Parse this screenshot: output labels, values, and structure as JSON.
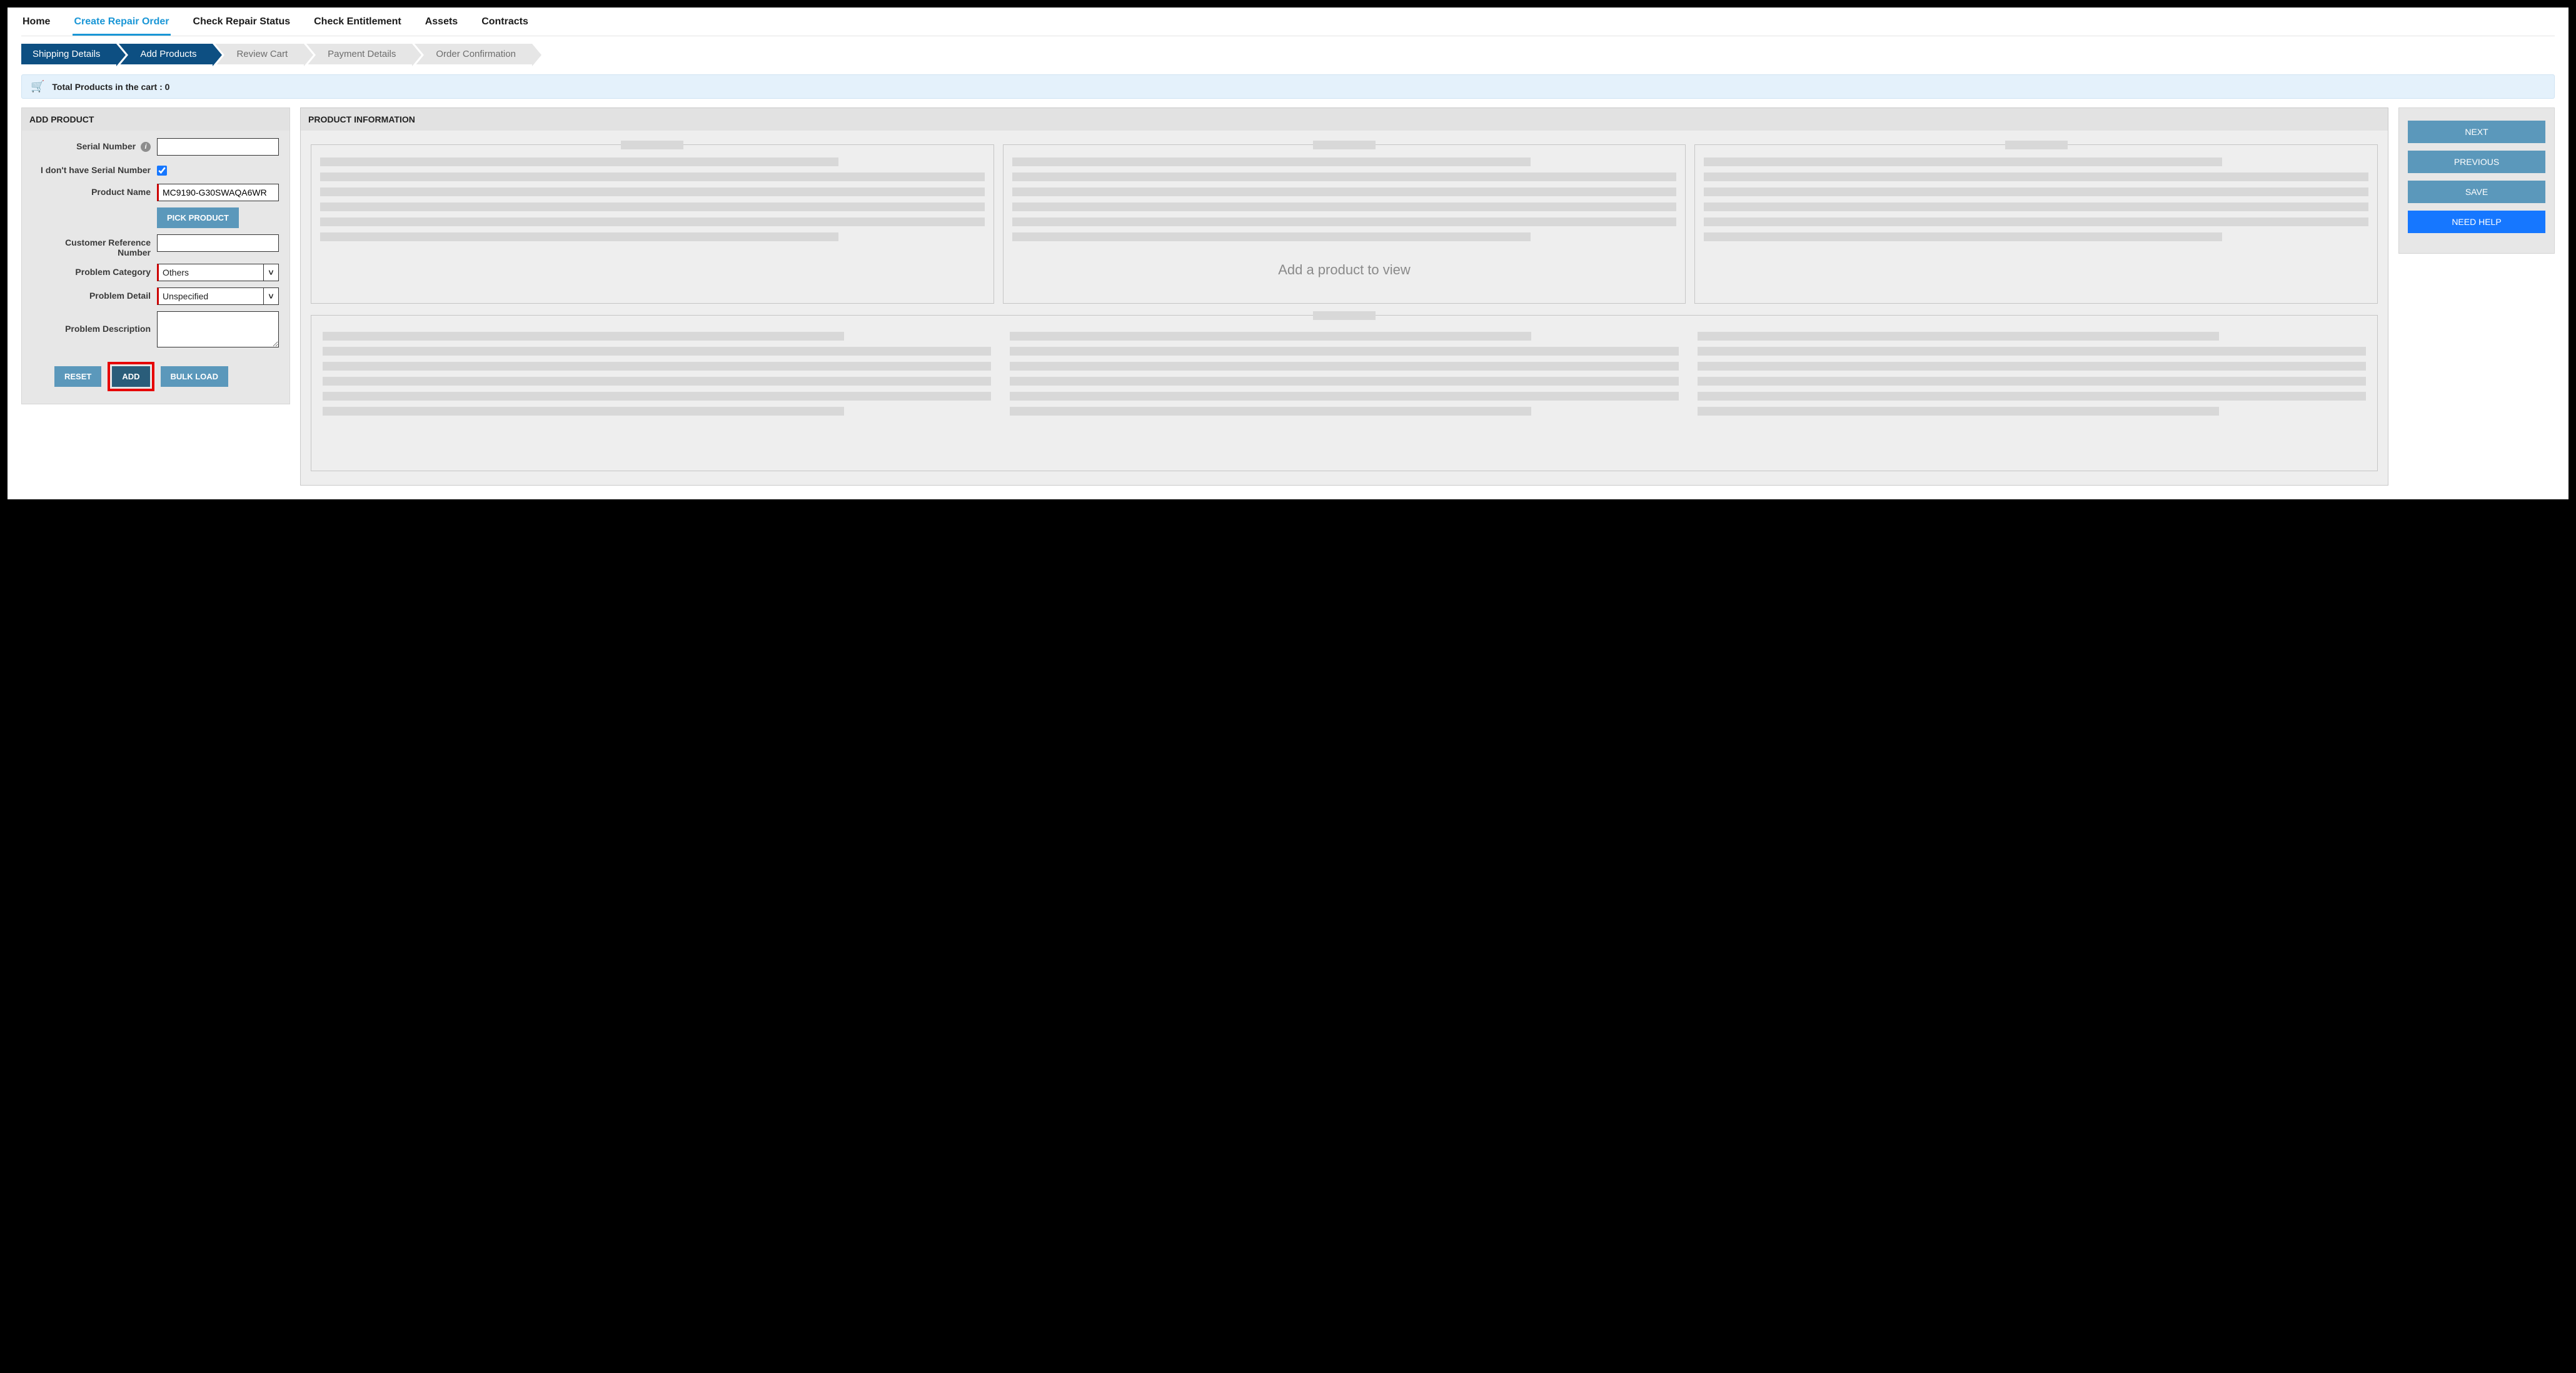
{
  "nav": {
    "home": "Home",
    "create_repair_order": "Create Repair Order",
    "check_repair_status": "Check Repair Status",
    "check_entitlement": "Check Entitlement",
    "assets": "Assets",
    "contracts": "Contracts"
  },
  "wizard": {
    "shipping_details": "Shipping Details",
    "add_products": "Add Products",
    "review_cart": "Review Cart",
    "payment_details": "Payment Details",
    "order_confirmation": "Order Confirmation"
  },
  "cart": {
    "label_prefix": "Total Products in the cart : ",
    "count": "0"
  },
  "add_product": {
    "title": "ADD PRODUCT",
    "serial_number_label": "Serial Number",
    "serial_number_value": "",
    "no_serial_label": "I don't have Serial Number",
    "no_serial_checked": true,
    "product_name_label": "Product Name",
    "product_name_value": "MC9190-G30SWAQA6WR",
    "pick_product": "PICK PRODUCT",
    "customer_ref_label": "Customer Reference Number",
    "customer_ref_value": "",
    "problem_category_label": "Problem Category",
    "problem_category_value": "Others",
    "problem_detail_label": "Problem Detail",
    "problem_detail_value": "Unspecified",
    "problem_description_label": "Problem Description",
    "problem_description_value": "",
    "reset": "RESET",
    "add": "ADD",
    "bulk_load": "BULK LOAD"
  },
  "product_info": {
    "title": "PRODUCT INFORMATION",
    "placeholder": "Add a product to view"
  },
  "actions": {
    "next": "NEXT",
    "previous": "PREVIOUS",
    "save": "SAVE",
    "need_help": "NEED HELP"
  },
  "colors": {
    "accent_light": "#5b98bb",
    "accent_dark": "#2a5d7a",
    "blue": "#1677ff",
    "wizard_done": "#0d4f82",
    "tab_active": "#1996d6",
    "highlight": "#e60000"
  }
}
